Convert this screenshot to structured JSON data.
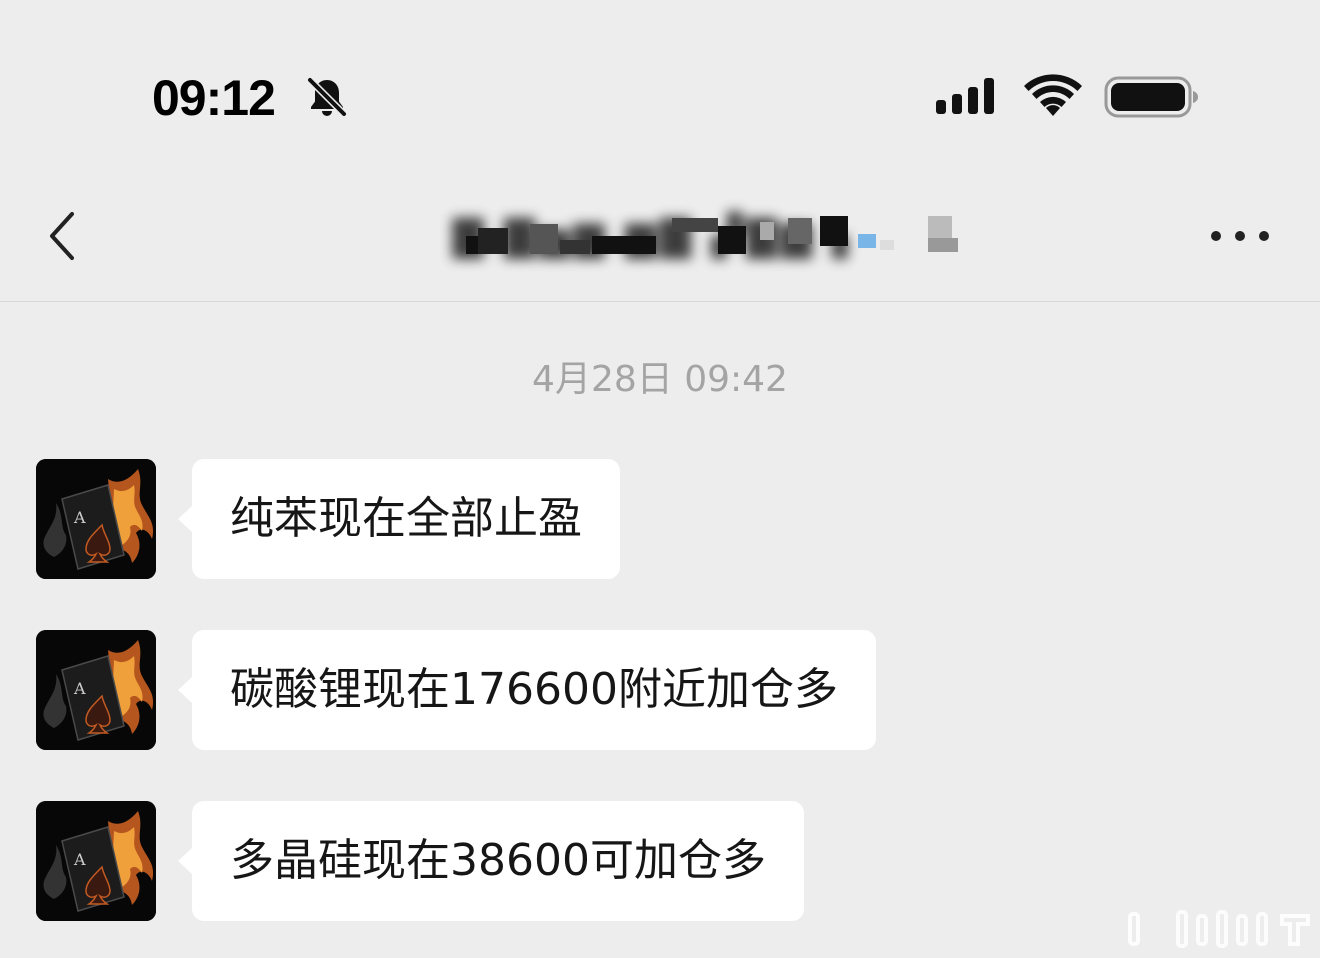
{
  "status_bar": {
    "time": "09:12",
    "icons": [
      "bell-slash-icon",
      "cellular-signal-icon",
      "wifi-icon",
      "battery-icon"
    ]
  },
  "nav": {
    "back_icon": "chevron-left-icon",
    "title": "▇ ▇▅▆ ▆▇ ▞▇▆ ▖",
    "more_icon": "more-horizontal-icon"
  },
  "timestamp": "4月28日 09:42",
  "messages": [
    {
      "text": "纯苯现在全部止盈",
      "avatar": "ace-of-spades-fire-avatar"
    },
    {
      "text": "碳酸锂现在176600附近加仓多",
      "avatar": "ace-of-spades-fire-avatar"
    },
    {
      "text": "多晶硅现在38600可加仓多",
      "avatar": "ace-of-spades-fire-avatar"
    }
  ],
  "colors": {
    "background": "#ededed",
    "bubble": "#ffffff",
    "timestamp_text": "#a4a4a4",
    "message_text": "#161616"
  }
}
